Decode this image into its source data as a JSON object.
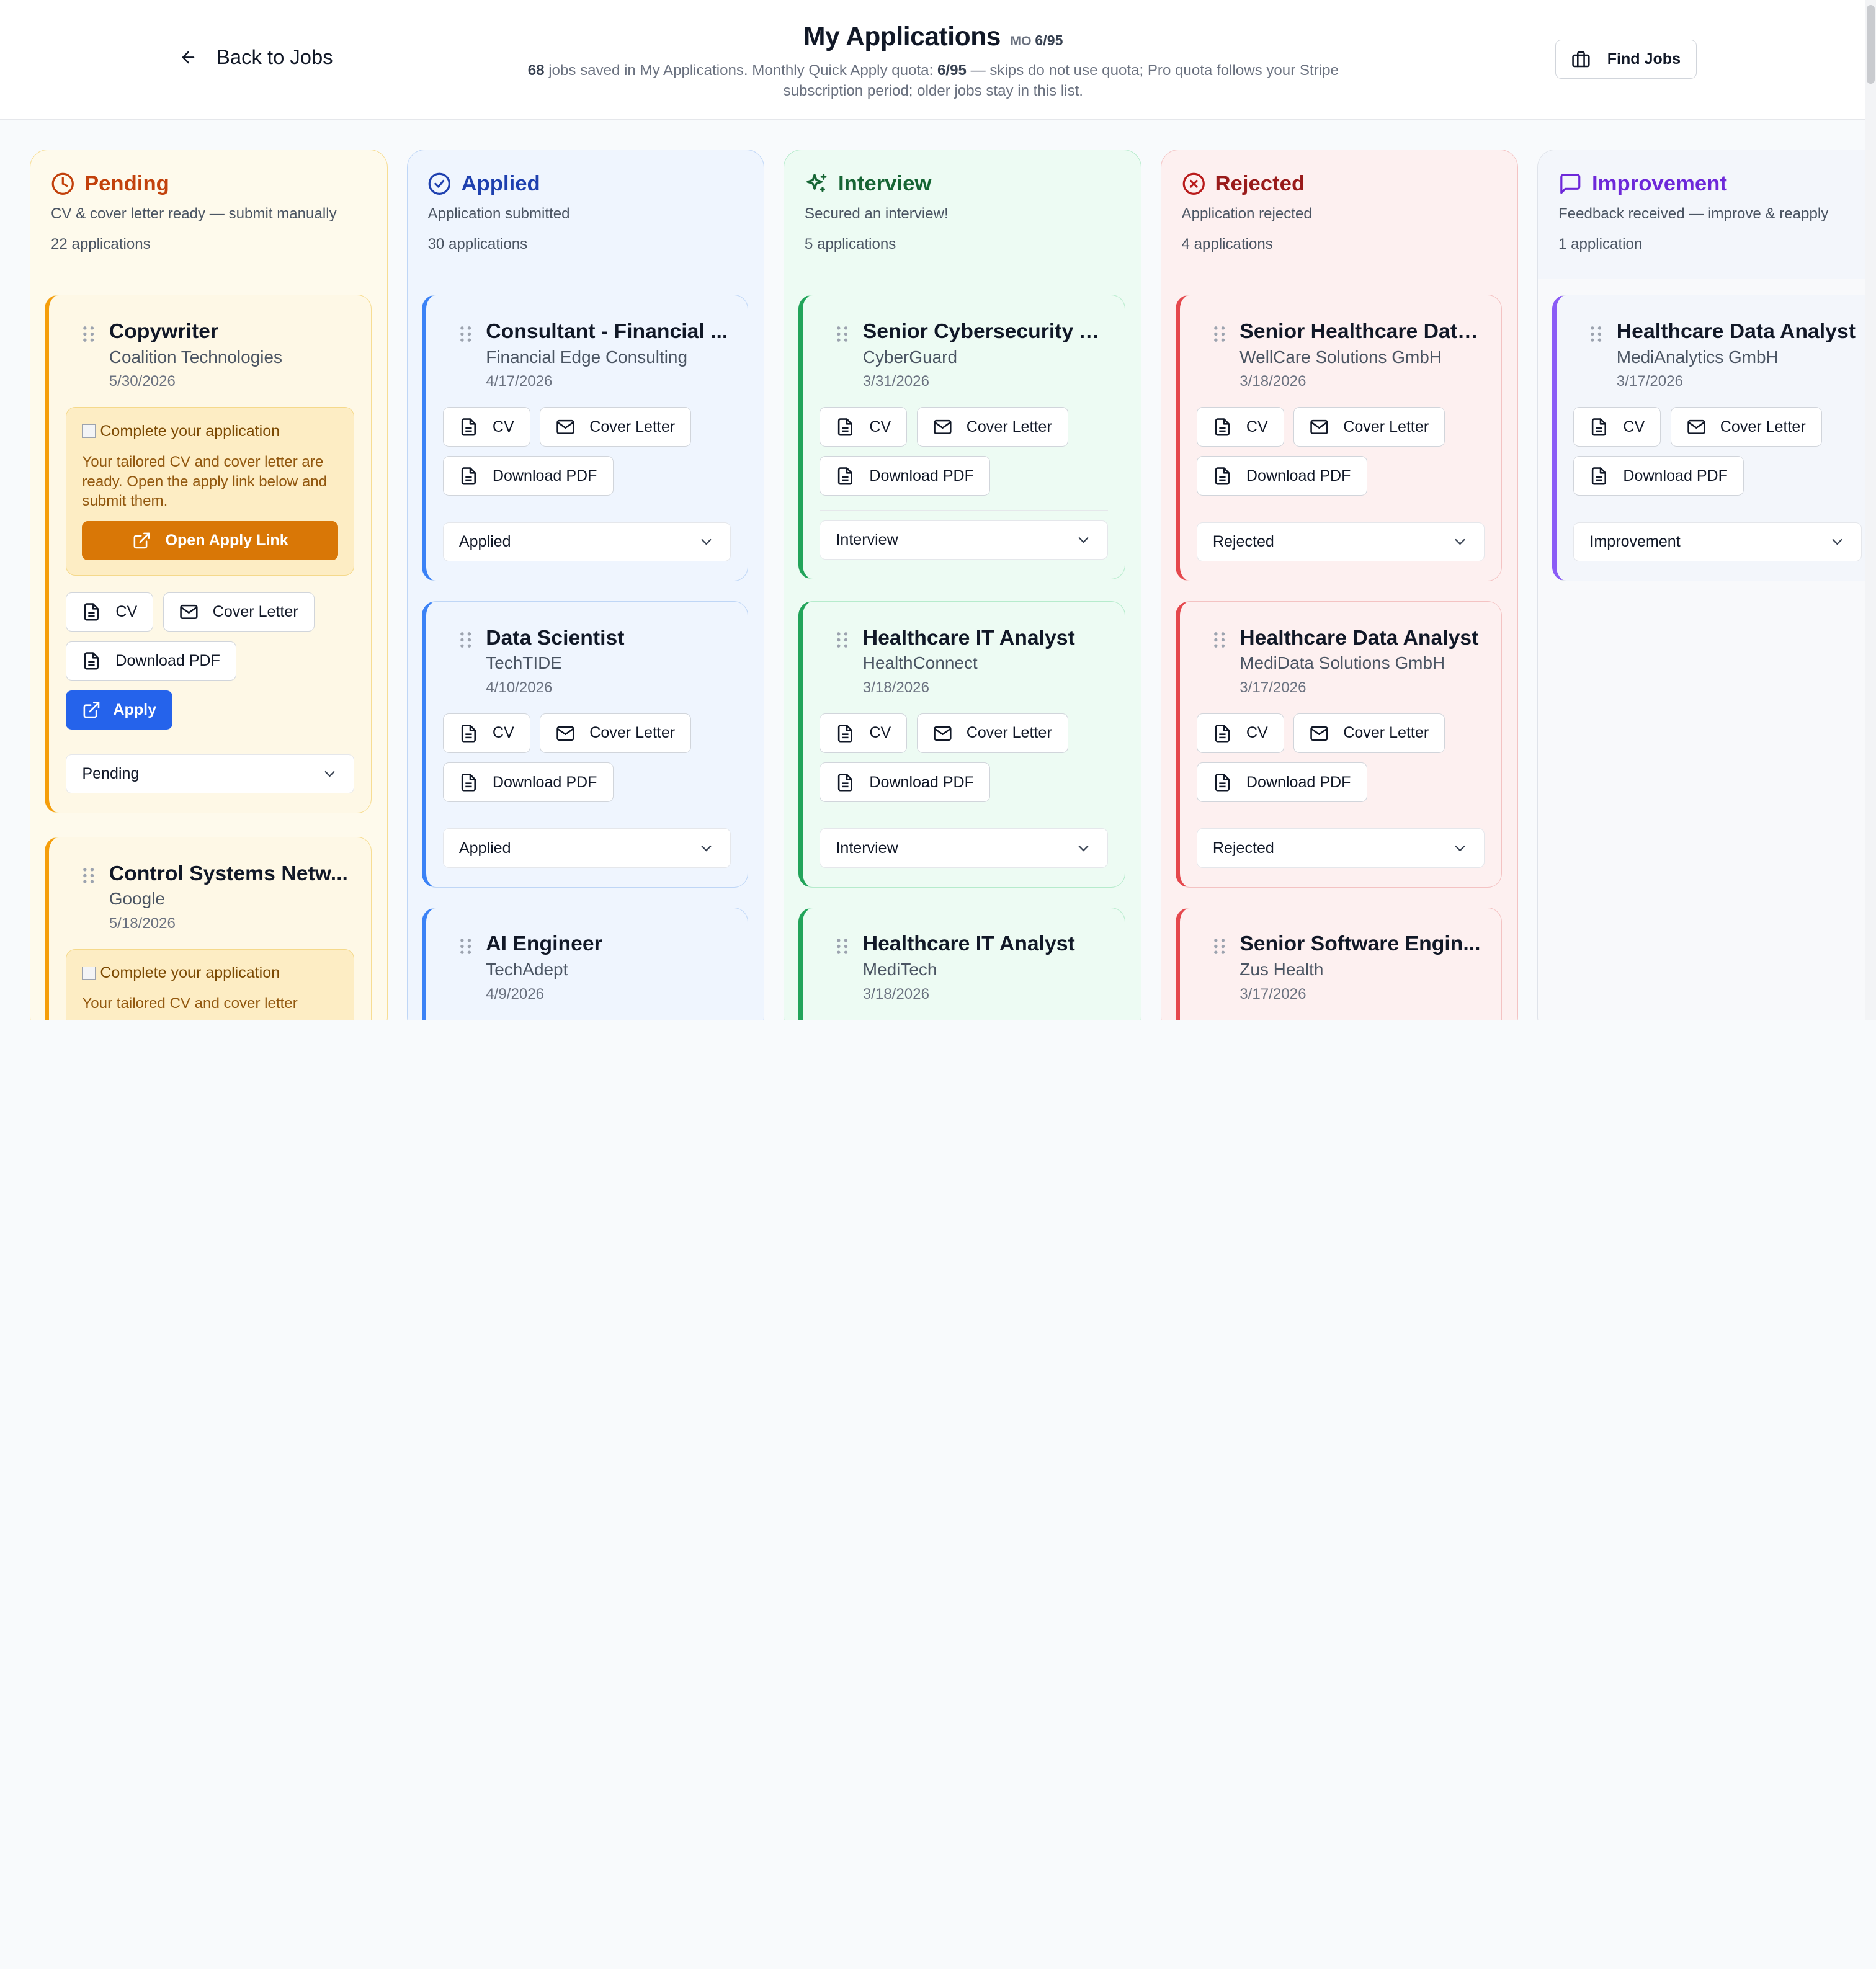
{
  "header": {
    "back_label": "Back to Jobs",
    "title": "My Applications",
    "quota_badge_prefix": "MO",
    "quota_badge_value": "6/95",
    "subtitle_count": "68",
    "subtitle_part1": " jobs saved in My Applications. Monthly Quick Apply quota: ",
    "subtitle_quota": "6/95",
    "subtitle_part2": " — skips do not use quota; Pro quota follows your Stripe subscription period; older jobs stay in this list.",
    "find_jobs_label": "Find Jobs"
  },
  "labels": {
    "cv": "CV",
    "cover_letter": "Cover Letter",
    "download_pdf": "Download PDF",
    "apply": "Apply",
    "open_apply_link": "Open Apply Link",
    "complete_title": "Complete your application",
    "complete_text": "Your tailored CV and cover letter are ready. Open the apply link below and submit them.",
    "complete_text_partial": "Your tailored CV and cover letter"
  },
  "colors": {
    "pending": "#c2410c",
    "applied": "#1e40af",
    "interview": "#166534",
    "rejected": "#991b1b",
    "improvement": "#6d28d9",
    "apply_button": "#2563eb",
    "open_apply_button": "#d97706"
  },
  "columns": {
    "pending": {
      "title": "Pending",
      "icon": "clock-icon",
      "description": "CV & cover letter ready — submit manually",
      "count": "22 applications",
      "cards": [
        {
          "title": "Copywriter",
          "company": "Coalition Technologies",
          "date": "5/30/2026",
          "status": "Pending"
        },
        {
          "title": "Control Systems Netw...",
          "company": "Google",
          "date": "5/18/2026"
        }
      ]
    },
    "applied": {
      "title": "Applied",
      "icon": "check-circle-icon",
      "description": "Application submitted",
      "count": "30 applications",
      "cards": [
        {
          "title": "Consultant - Financial ...",
          "company": "Financial Edge Consulting",
          "date": "4/17/2026",
          "status": "Applied"
        },
        {
          "title": "Data Scientist",
          "company": "TechTIDE",
          "date": "4/10/2026",
          "status": "Applied"
        },
        {
          "title": "AI Engineer",
          "company": "TechAdept",
          "date": "4/9/2026"
        }
      ]
    },
    "interview": {
      "title": "Interview",
      "icon": "sparkles-icon",
      "description": "Secured an interview!",
      "count": "5 applications",
      "cards": [
        {
          "title": "Senior Cybersecurity A...",
          "company": "CyberGuard",
          "date": "3/31/2026",
          "status": "Interview"
        },
        {
          "title": "Healthcare IT Analyst",
          "company": "HealthConnect",
          "date": "3/18/2026",
          "status": "Interview"
        },
        {
          "title": "Healthcare IT Analyst",
          "company": "MediTech",
          "date": "3/18/2026"
        }
      ]
    },
    "rejected": {
      "title": "Rejected",
      "icon": "x-circle-icon",
      "description": "Application rejected",
      "count": "4 applications",
      "cards": [
        {
          "title": "Senior Healthcare Data...",
          "company": "WellCare Solutions GmbH",
          "date": "3/18/2026",
          "status": "Rejected"
        },
        {
          "title": "Healthcare Data Analyst",
          "company": "MediData Solutions GmbH",
          "date": "3/17/2026",
          "status": "Rejected"
        },
        {
          "title": "Senior Software Engin...",
          "company": "Zus Health",
          "date": "3/17/2026"
        }
      ]
    },
    "improvement": {
      "title": "Improvement",
      "icon": "message-square-icon",
      "description": "Feedback received — improve & reapply",
      "count": "1 application",
      "cards": [
        {
          "title": "Healthcare Data Analyst",
          "company": "MediAnalytics GmbH",
          "date": "3/17/2026",
          "status": "Improvement"
        }
      ]
    }
  }
}
